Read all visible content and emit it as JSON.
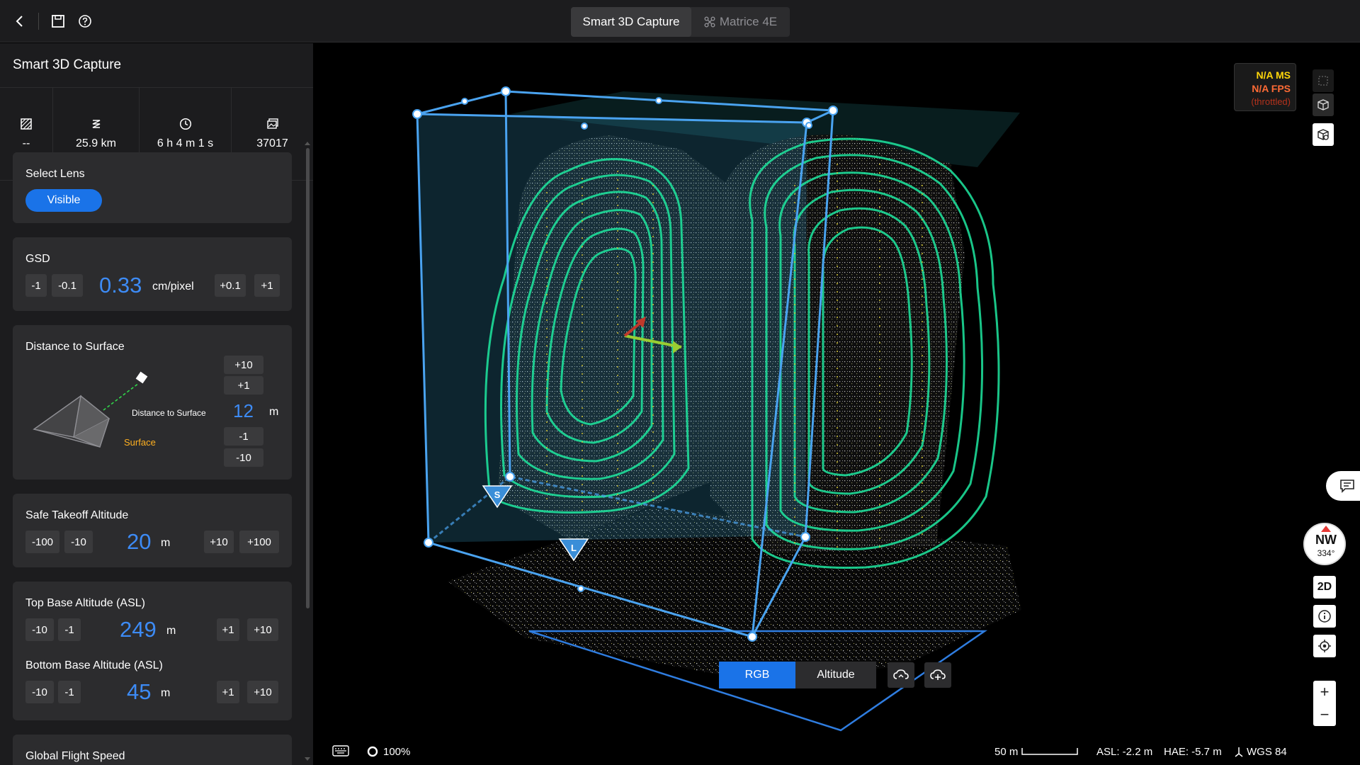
{
  "topbar": {
    "tabs": [
      {
        "label": "Smart 3D Capture"
      },
      {
        "label": "Matrice 4E"
      }
    ]
  },
  "sidebar": {
    "title": "Smart 3D Capture",
    "stats": [
      {
        "icon": "area-icon",
        "value": "--"
      },
      {
        "icon": "route-icon",
        "value": "25.9 km"
      },
      {
        "icon": "clock-icon",
        "value": "6 h 4 m 1 s"
      },
      {
        "icon": "photos-icon",
        "value": "37017"
      }
    ],
    "lens": {
      "title": "Select Lens",
      "option": "Visible"
    },
    "gsd": {
      "title": "GSD",
      "dec1": "-1",
      "dec2": "-0.1",
      "value": "0.33",
      "unit": "cm/pixel",
      "inc1": "+0.1",
      "inc2": "+1"
    },
    "distance": {
      "title": "Distance to Surface",
      "diagram_label": "Distance to Surface",
      "surface_label": "Surface",
      "inc2": "+10",
      "inc1": "+1",
      "value": "12",
      "unit": "m",
      "dec1": "-1",
      "dec2": "-10"
    },
    "takeoff": {
      "title": "Safe Takeoff Altitude",
      "dec2": "-100",
      "dec1": "-10",
      "value": "20",
      "unit": "m",
      "inc1": "+10",
      "inc2": "+100"
    },
    "top_base": {
      "title": "Top Base Altitude (ASL)",
      "dec2": "-10",
      "dec1": "-1",
      "value": "249",
      "unit": "m",
      "inc1": "+1",
      "inc2": "+10"
    },
    "bottom_base": {
      "title": "Bottom Base Altitude (ASL)",
      "dec2": "-10",
      "dec1": "-1",
      "value": "45",
      "unit": "m",
      "inc1": "+1",
      "inc2": "+10"
    },
    "speed": {
      "title": "Global Flight Speed"
    }
  },
  "viewport": {
    "perf": {
      "ms": "N/A MS",
      "fps": "N/A FPS",
      "throttled": "(throttled)"
    },
    "compass": {
      "direction": "NW",
      "degrees": "334°"
    },
    "view_mode": "2D",
    "color_modes": {
      "rgb": "RGB",
      "altitude": "Altitude"
    },
    "markers": {
      "start": "S",
      "land": "L"
    },
    "status": {
      "opacity": "100%",
      "scale": "50 m",
      "asl": "ASL: -2.2 m",
      "hae": "HAE: -5.7 m",
      "datum": "WGS 84"
    }
  },
  "colors": {
    "accent": "#1a73e8",
    "value_blue": "#3d8bf5",
    "path_green": "#1ee8a0",
    "box_blue": "#4aa3f0"
  }
}
